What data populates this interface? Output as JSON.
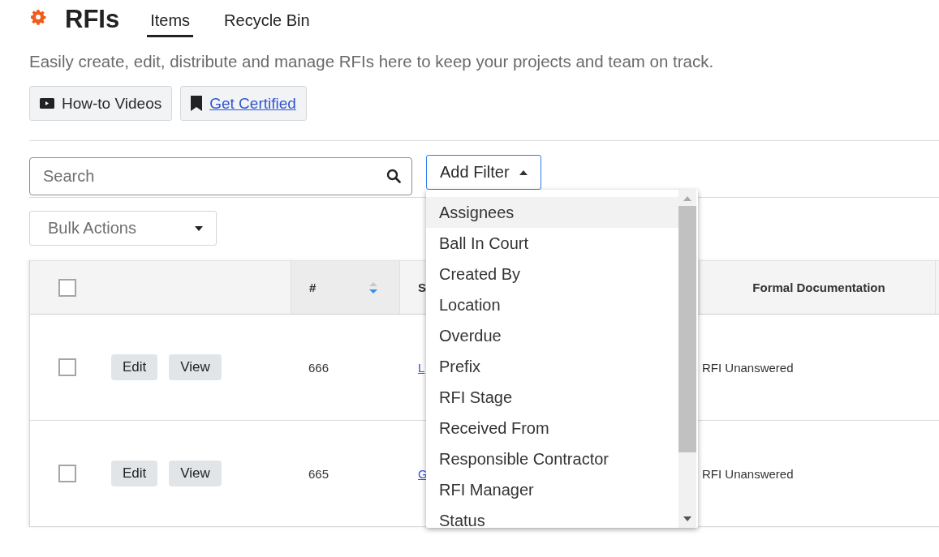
{
  "header": {
    "title": "RFIs",
    "tabs": [
      {
        "label": "Items",
        "selected": true
      },
      {
        "label": "Recycle Bin",
        "selected": false
      }
    ]
  },
  "description": "Easily create, edit, distribute and manage RFIs here to keep your projects and team on track.",
  "resource_buttons": [
    {
      "kind": "video",
      "label": "How-to Videos",
      "link": false
    },
    {
      "kind": "bookmark",
      "label": "Get Certified",
      "link": true
    }
  ],
  "search": {
    "placeholder": "Search"
  },
  "filter_button": {
    "label": "Add Filter",
    "expanded": true
  },
  "filter_menu": [
    {
      "label": "Assignees",
      "selected": true
    },
    {
      "label": "Ball In Court",
      "selected": false
    },
    {
      "label": "Created By",
      "selected": false
    },
    {
      "label": "Location",
      "selected": false
    },
    {
      "label": "Overdue",
      "selected": false
    },
    {
      "label": "Prefix",
      "selected": false
    },
    {
      "label": "RFI Stage",
      "selected": false
    },
    {
      "label": "Received From",
      "selected": false
    },
    {
      "label": "Responsible Contractor",
      "selected": false
    },
    {
      "label": "RFI Manager",
      "selected": false
    },
    {
      "label": "Status",
      "selected": false
    }
  ],
  "bulk_actions": {
    "placeholder": "Bulk Actions"
  },
  "table": {
    "select_all_checked": false,
    "columns": [
      {
        "label": "#",
        "sortable": true
      },
      {
        "label": "S",
        "sortable": false
      },
      {
        "label": "Formal Documentation",
        "sortable": false
      }
    ],
    "rows": [
      {
        "checked": false,
        "actions": [
          "Edit",
          "View"
        ],
        "number": "666",
        "subject": "L",
        "formal_documentation": "RFI Unanswered"
      },
      {
        "checked": false,
        "actions": [
          "Edit",
          "View"
        ],
        "number": "665",
        "subject": "G",
        "formal_documentation": "RFI Unanswered"
      }
    ]
  }
}
